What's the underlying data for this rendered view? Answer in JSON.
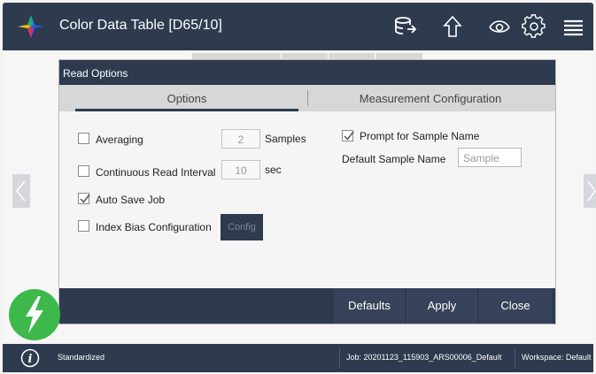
{
  "app": {
    "title": "Color Data Table [D65/10]"
  },
  "toolbar": {
    "icons": [
      "database-export-icon",
      "upload-arrow-icon",
      "eye-icon",
      "gear-icon",
      "menu-icon"
    ]
  },
  "dialog": {
    "title": "Read Options",
    "tabs": [
      {
        "label": "Options",
        "active": true
      },
      {
        "label": "Measurement Configuration",
        "active": false
      }
    ],
    "options": {
      "averaging": {
        "label": "Averaging",
        "checked": false,
        "value": "2",
        "unit": "Samples"
      },
      "continuous_read": {
        "label": "Continuous Read Interval",
        "checked": false,
        "value": "10",
        "unit": "sec"
      },
      "auto_save": {
        "label": "Auto Save Job",
        "checked": true
      },
      "index_bias": {
        "label": "Index Bias Configuration",
        "checked": false,
        "button": "Config"
      },
      "prompt_sample": {
        "label": "Prompt for Sample Name",
        "checked": true
      },
      "default_sample": {
        "label": "Default Sample Name",
        "placeholder": "Sample"
      }
    },
    "footer": {
      "defaults": "Defaults",
      "apply": "Apply",
      "close": "Close"
    }
  },
  "status": {
    "standardized": "Standardized",
    "job": "Job: 20201123_115903_ARS00006_Default",
    "workspace": "Workspace: Default"
  },
  "colors": {
    "header": "#2e3a4e",
    "fab": "#3db84a",
    "tab_bar": "#d7d7d7"
  }
}
